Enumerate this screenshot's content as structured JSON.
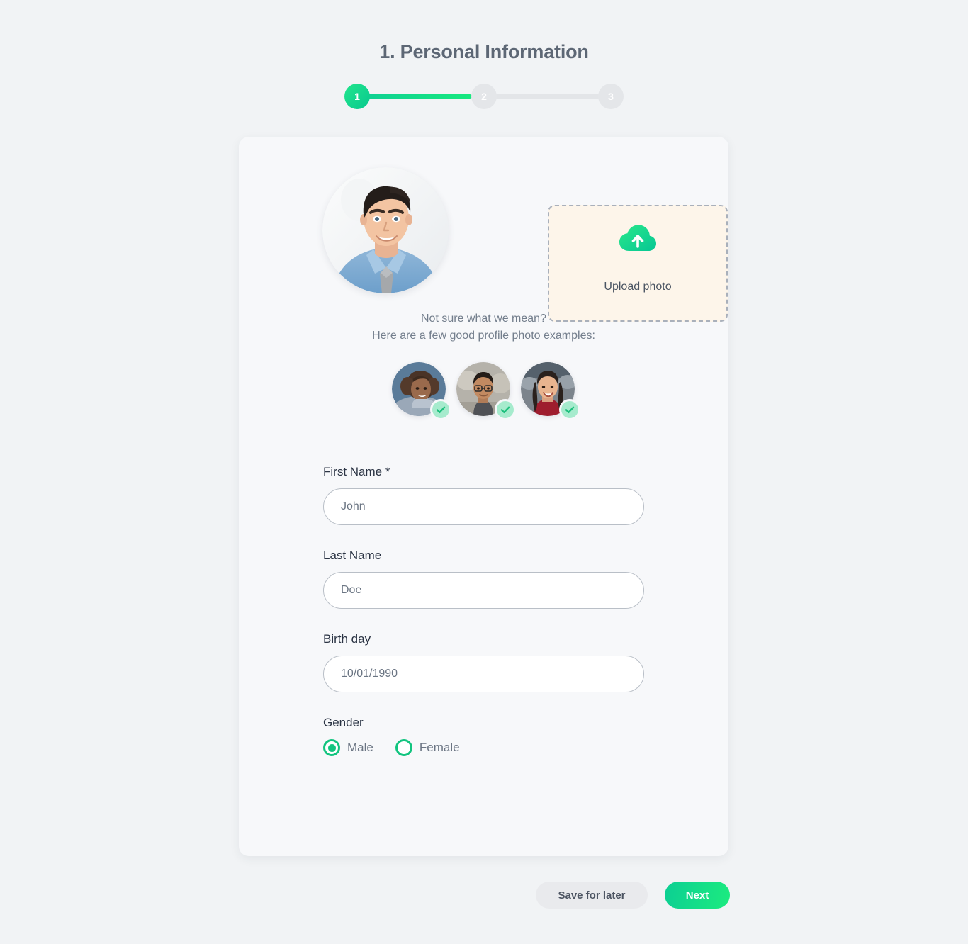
{
  "header": {
    "title": "1. Personal Information"
  },
  "stepper": {
    "steps": [
      {
        "number": "1",
        "state": "active"
      },
      {
        "number": "2",
        "state": "inactive"
      },
      {
        "number": "3",
        "state": "inactive"
      }
    ],
    "active_color": "#12c47f",
    "inactive_color": "#e4e6e9"
  },
  "photo": {
    "avatar_icon": "user-photo-man",
    "upload": {
      "icon": "cloud-upload-icon",
      "label": "Upload photo"
    },
    "hint_line1": "Not sure what we mean?",
    "hint_line2": "Here are a few good profile photo examples:",
    "examples": [
      {
        "icon": "example-photo-woman-curly",
        "badge": "check-icon"
      },
      {
        "icon": "example-photo-man-glasses",
        "badge": "check-icon"
      },
      {
        "icon": "example-photo-woman-red",
        "badge": "check-icon"
      }
    ]
  },
  "form": {
    "fields": [
      {
        "label": "First Name *",
        "placeholder": "John",
        "value": ""
      },
      {
        "label": "Last Name",
        "placeholder": "Doe",
        "value": ""
      },
      {
        "label": "Birth day",
        "placeholder": "10/01/1990",
        "value": ""
      }
    ],
    "gender": {
      "label": "Gender",
      "options": [
        {
          "label": "Male",
          "selected": true
        },
        {
          "label": "Female",
          "selected": false
        }
      ]
    }
  },
  "footer": {
    "save_label": "Save for later",
    "next_label": "Next"
  },
  "colors": {
    "accent_green": "#12c47f",
    "page_bg": "#f1f3f5",
    "card_bg": "#f7f8fa",
    "upload_bg": "#fdf5ea",
    "title_text": "#5d6775"
  }
}
